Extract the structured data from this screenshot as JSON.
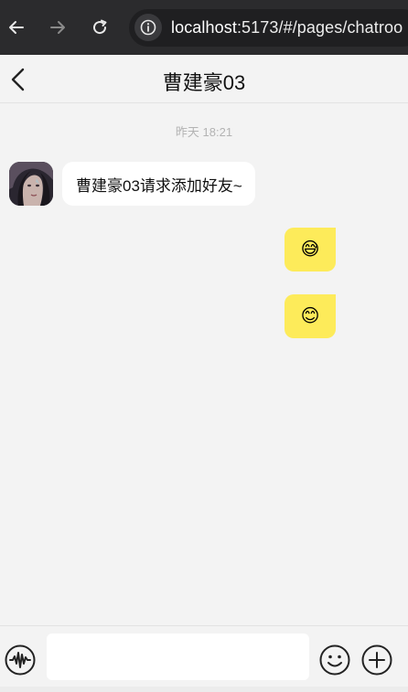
{
  "browser": {
    "url_host": "localhost",
    "url_rest": ":5173/#/pages/chatroo",
    "icons": {
      "back": "arrow-left-icon",
      "forward": "arrow-right-icon",
      "reload": "reload-icon",
      "site_info": "info-icon"
    }
  },
  "header": {
    "title": "曹建豪03",
    "back_icon": "chevron-left-icon"
  },
  "chat": {
    "timestamp": "昨天 18:21",
    "messages": [
      {
        "side": "left",
        "text": "曹建豪03请求添加好友~"
      },
      {
        "side": "right",
        "text": "😅"
      },
      {
        "side": "right",
        "text": "😊"
      }
    ]
  },
  "input_bar": {
    "message_value": "",
    "icons": {
      "voice": "voice-wave-icon",
      "emoji": "smile-icon",
      "plus": "plus-circle-icon"
    }
  },
  "colors": {
    "browser_bg": "#2b2b2d",
    "page_bg": "#f3f3f3",
    "my_bubble": "#fdeb5a",
    "their_bubble": "#ffffff"
  }
}
